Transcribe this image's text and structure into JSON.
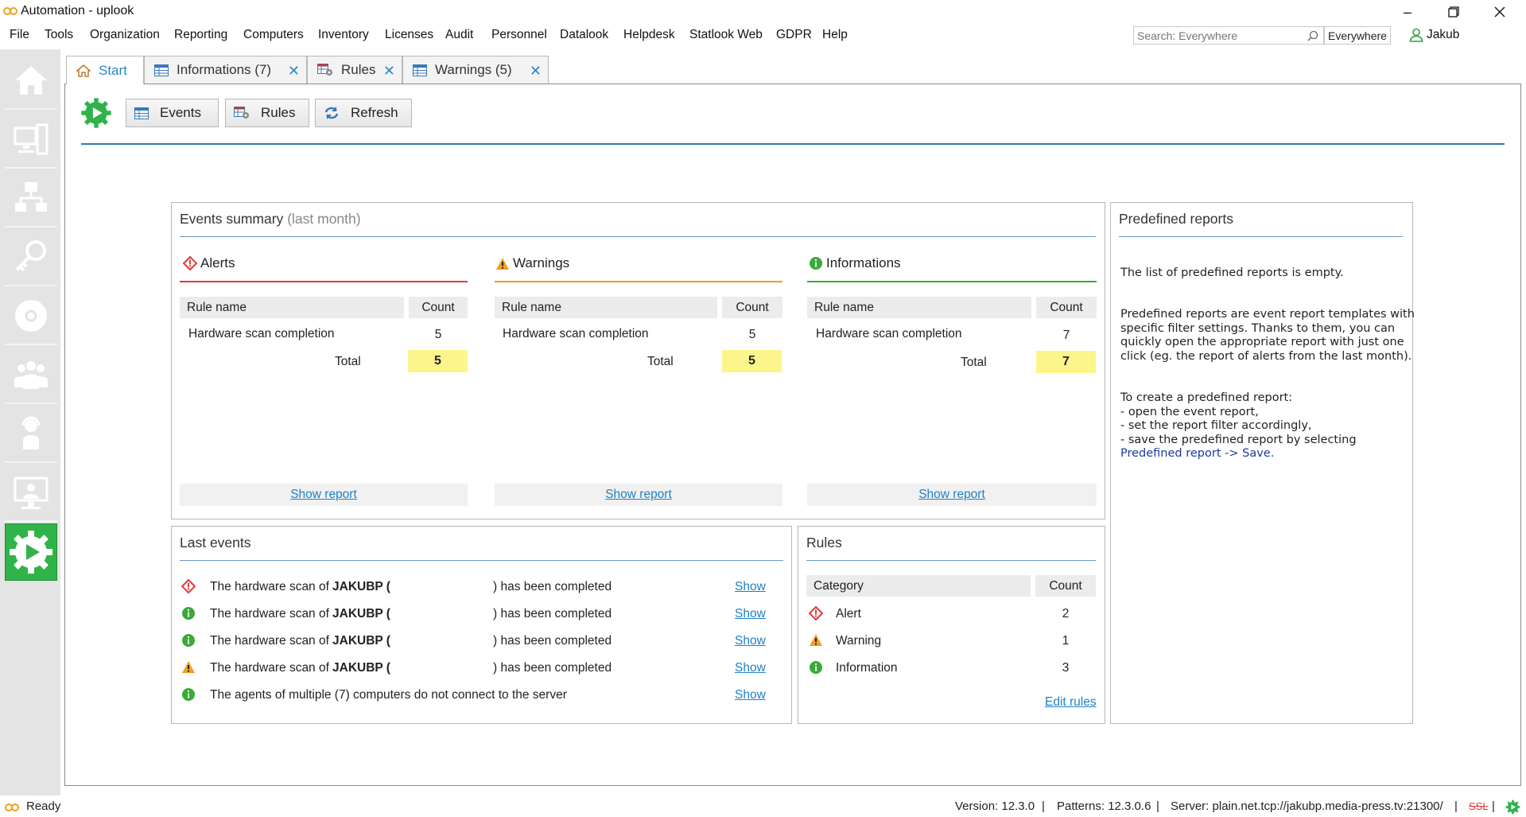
{
  "window": {
    "title": "Automation - uplook"
  },
  "menu": [
    "File",
    "Tools",
    "Organization",
    "Reporting",
    "Computers",
    "Inventory",
    "Licenses",
    "Audit",
    "Personnel",
    "Datalook",
    "Helpdesk",
    "Statlook Web",
    "GDPR",
    "Help"
  ],
  "search": {
    "placeholder": "Search: Everywhere",
    "scope": "Everywhere"
  },
  "user": {
    "name": "Jakub"
  },
  "sidebar": {
    "items": [
      "home",
      "computers",
      "network",
      "licenses",
      "media",
      "personnel",
      "helpdesk",
      "statlook",
      "automation"
    ]
  },
  "tabs": [
    {
      "label": "Start",
      "active": true
    },
    {
      "label": "Informations (7)"
    },
    {
      "label": "Rules"
    },
    {
      "label": "Warnings (5)"
    }
  ],
  "toolbar": {
    "events": "Events",
    "rules": "Rules",
    "refresh": "Refresh"
  },
  "events_summary": {
    "title": "Events summary",
    "subtitle": "(last month)",
    "col_rule": "Rule name",
    "col_count": "Count",
    "total_label": "Total",
    "show_report": "Show report",
    "sections": [
      {
        "title": "Alerts",
        "rule": "Hardware scan completion",
        "count": "5",
        "total": "5",
        "color": "#e03a3a"
      },
      {
        "title": "Warnings",
        "rule": "Hardware scan completion",
        "count": "5",
        "total": "5",
        "color": "#f0a020"
      },
      {
        "title": "Informations",
        "rule": "Hardware scan completion",
        "count": "7",
        "total": "7",
        "color": "#3aaa3a"
      }
    ]
  },
  "last_events": {
    "title": "Last events",
    "show": "Show",
    "items": [
      {
        "type": "alert",
        "text": "The hardware scan of",
        "bold": "JAKUBP (",
        "tail": ") has been completed"
      },
      {
        "type": "info",
        "text": "The hardware scan of",
        "bold": "JAKUBP (",
        "tail": ") has been completed"
      },
      {
        "type": "info",
        "text": "The hardware scan of",
        "bold": "JAKUBP (",
        "tail": ") has been completed"
      },
      {
        "type": "warning",
        "text": "The hardware scan of",
        "bold": "JAKUBP (",
        "tail": ") has been completed"
      },
      {
        "type": "info",
        "text": "The agents of multiple (7) computers do not connect to the server",
        "bold": "",
        "tail": ""
      }
    ]
  },
  "rules_panel": {
    "title": "Rules",
    "col_category": "Category",
    "col_count": "Count",
    "rows": [
      {
        "type": "alert",
        "category": "Alert",
        "count": "2"
      },
      {
        "type": "warning",
        "category": "Warning",
        "count": "1"
      },
      {
        "type": "info",
        "category": "Information",
        "count": "3"
      }
    ],
    "edit_link": "Edit rules"
  },
  "predefined": {
    "title": "Predefined reports",
    "empty": "The list of predefined reports is empty.",
    "description": "Predefined reports are event report templates with\nspecific filter settings. Thanks to them, you can\nquickly open the appropriate report with just one\nclick (eg. the report of alerts from the last month).",
    "howto": "To create a predefined report:\n- open the event report,\n- set the report filter accordingly,\n- save the predefined report by selecting",
    "howto_link": "Predefined report -> Save."
  },
  "status": {
    "ready": "Ready",
    "version": "Version: 12.3.0",
    "patterns": "Patterns: 12.3.0.6",
    "server": "Server: plain.net.tcp://jakubp.media-press.tv:21300/",
    "ssl": "SSL",
    "sep": "|"
  },
  "colors": {
    "accent": "#2b88c8",
    "active_green": "#2fb34a",
    "alert": "#e03a3a",
    "warning": "#f0a020",
    "info": "#3aaa3a",
    "total_bg": "#fbf58c"
  }
}
